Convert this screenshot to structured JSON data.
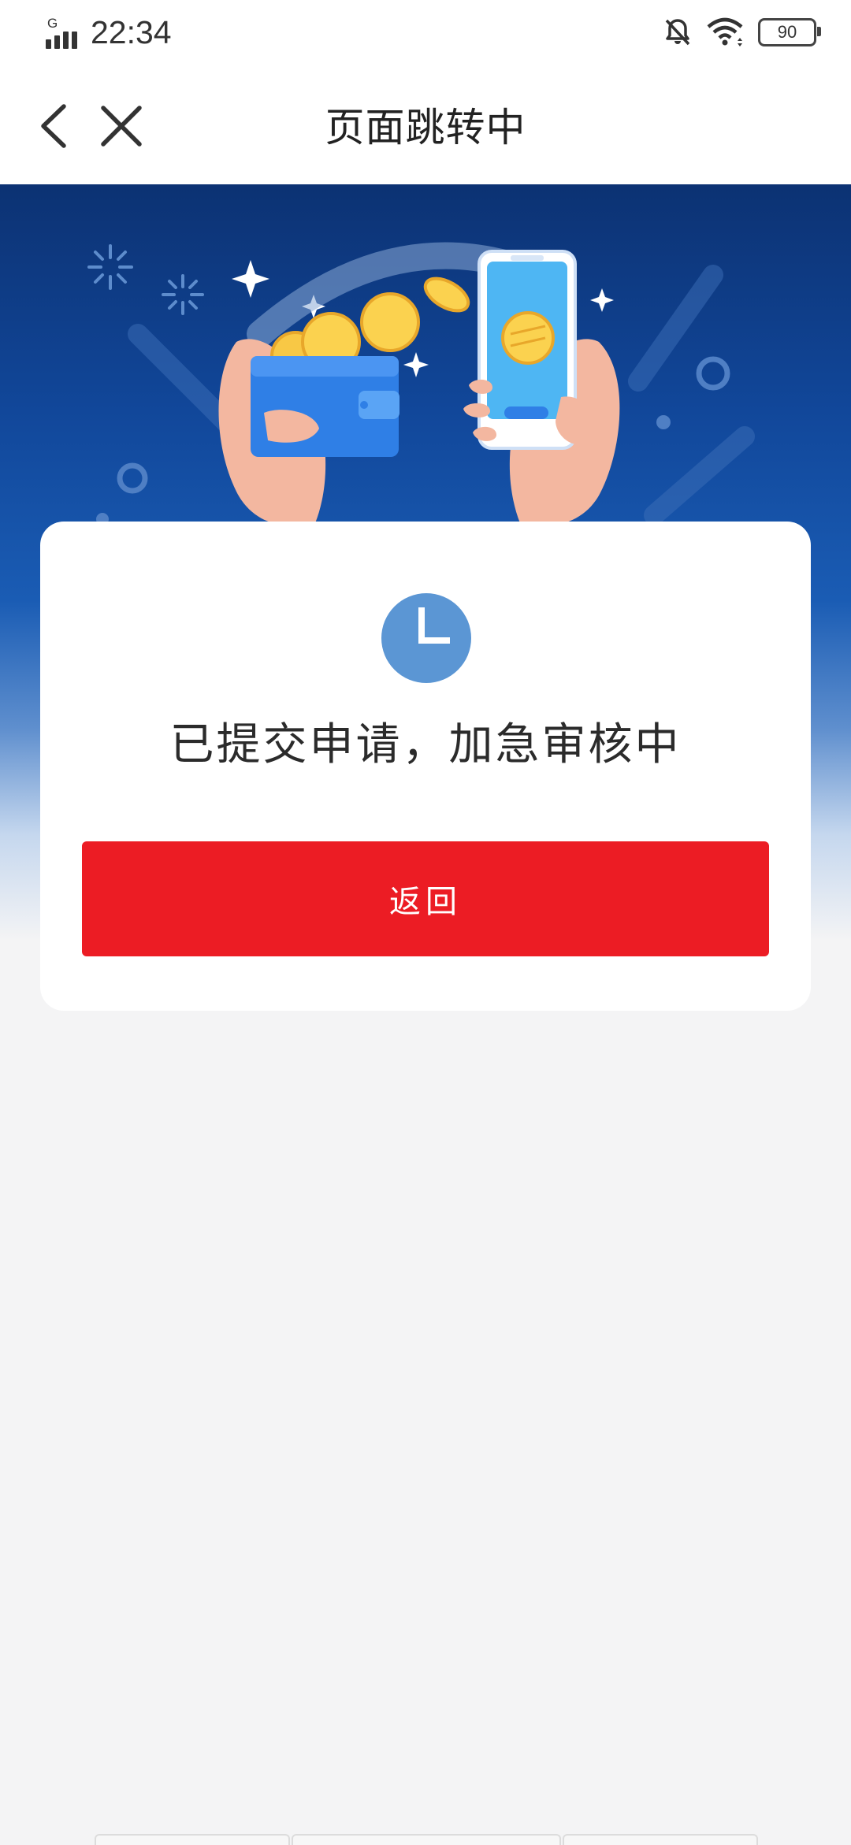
{
  "status_bar": {
    "network_type": "G",
    "time": "22:34",
    "battery_level": "90",
    "icons": [
      "signal-icon",
      "mute-bell-icon",
      "wifi-icon",
      "battery-icon"
    ]
  },
  "nav": {
    "title": "页面跳转中",
    "back_icon": "chevron-left-icon",
    "close_icon": "close-icon"
  },
  "result": {
    "status_icon": "clock-icon",
    "message": "已提交申请，加急审核中",
    "return_label": "返回"
  },
  "colors": {
    "accent_red": "#ec1c24",
    "hero_blue": "#11479a",
    "clock_blue": "#5b96d4",
    "page_background": "#f4f4f5"
  }
}
